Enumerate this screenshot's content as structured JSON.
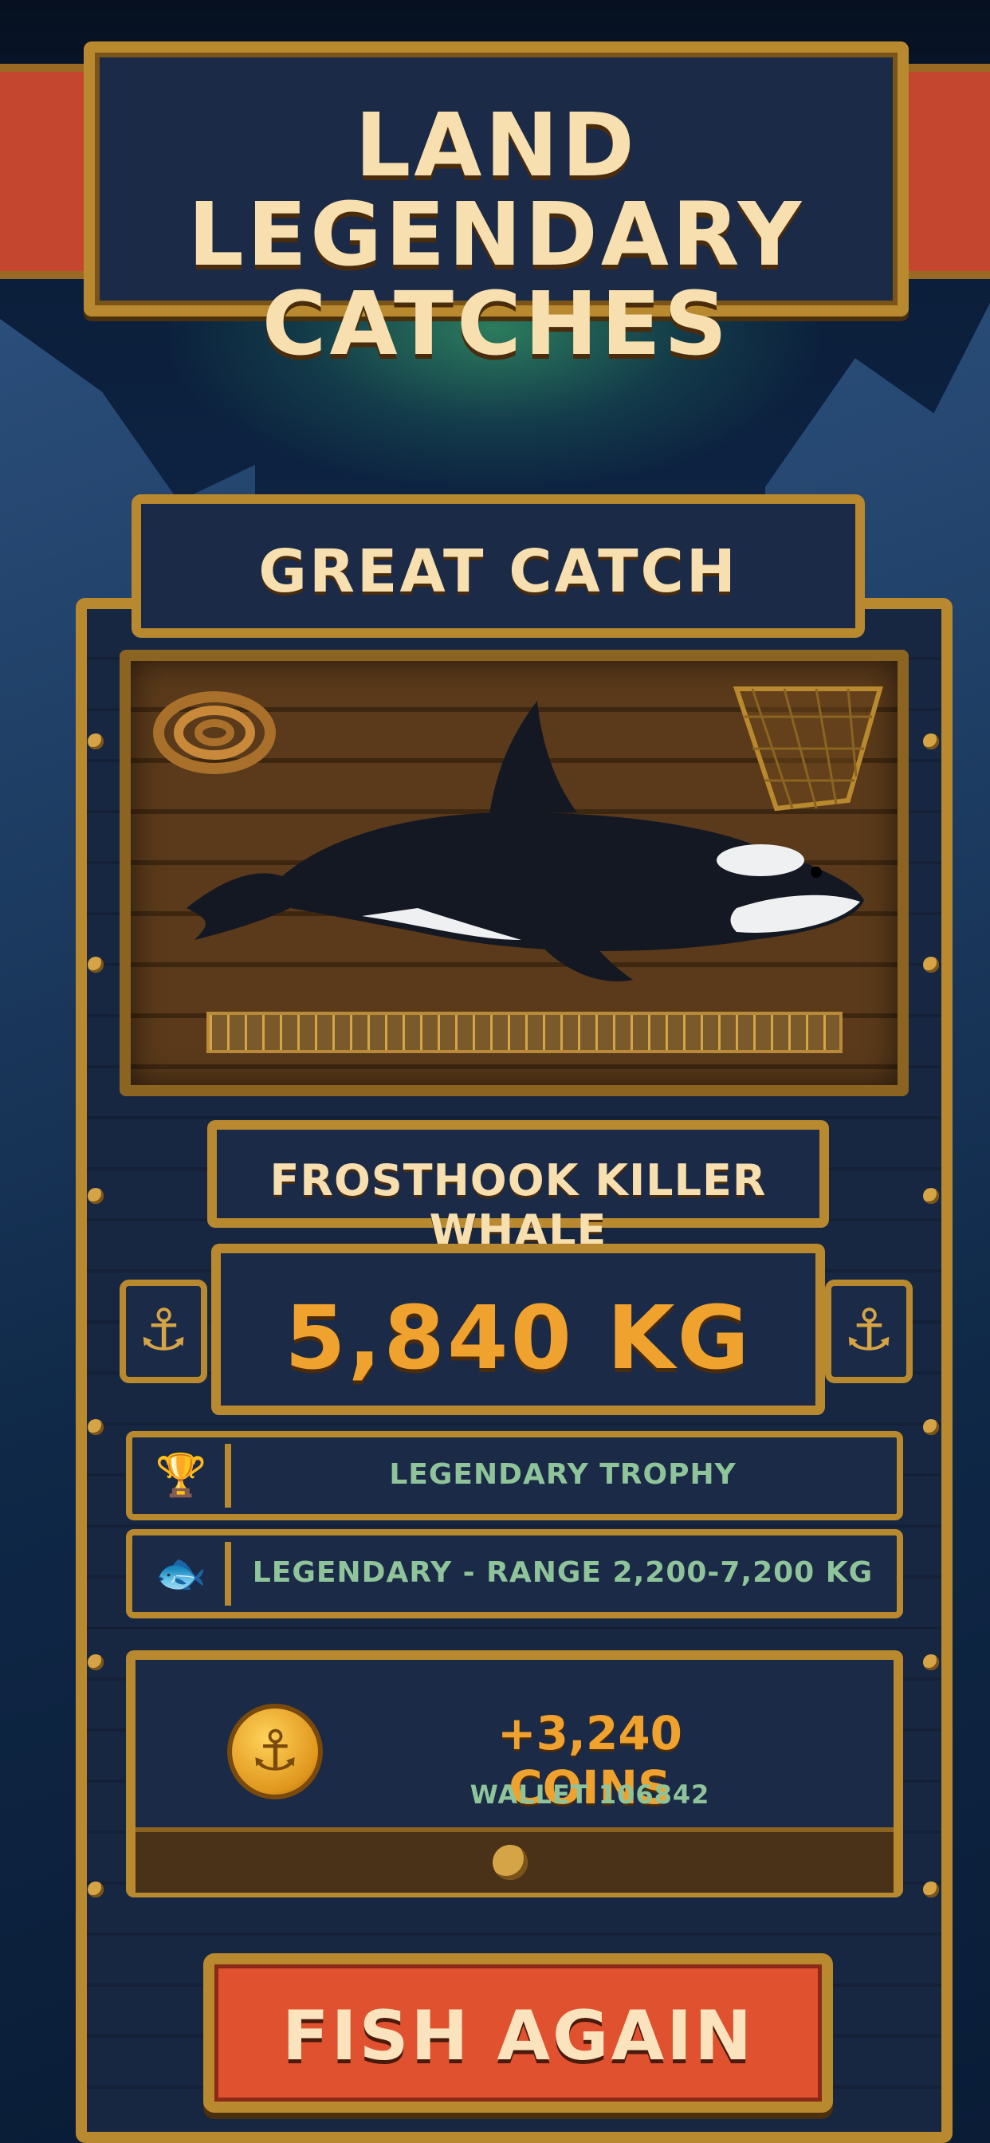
{
  "banner": {
    "title_line1": "LAND LEGENDARY",
    "title_line2": "CATCHES"
  },
  "result": {
    "header": "GREAT CATCH",
    "species": "FROSTHOOK KILLER WHALE",
    "weight": "5,840 KG",
    "trophy_row": {
      "icon": "trophy-icon",
      "text": "LEGENDARY TROPHY"
    },
    "rarity_row": {
      "icon": "fish-icon",
      "text": "LEGENDARY - RANGE 2,200-7,200 KG"
    }
  },
  "reward": {
    "coins": "+3,240 COINS",
    "wallet": "WALLET 106842",
    "icon": "anchor-coin-icon"
  },
  "actions": {
    "fish_again": "FISH AGAIN"
  },
  "colors": {
    "gold": "#b8892e",
    "panel": "#1a2a47",
    "accent_orange": "#f0a22e",
    "button_red": "#e0522f",
    "green_text": "#8fc49a"
  }
}
